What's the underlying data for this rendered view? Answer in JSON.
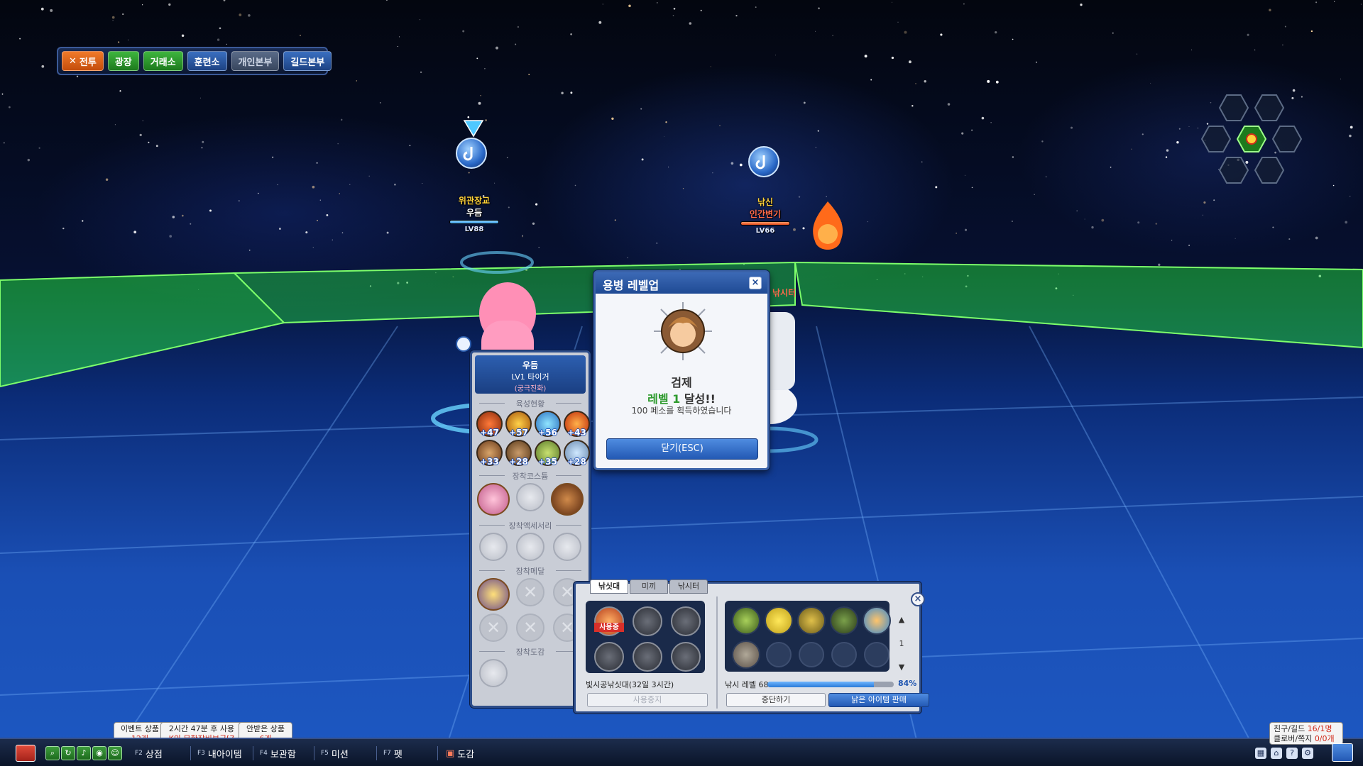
{
  "top_nav": {
    "battle": "전투",
    "plaza": "광장",
    "exchange": "거래소",
    "training": "훈련소",
    "personal_hq": "개인본부",
    "guild_hq": "길드본부"
  },
  "players": {
    "left": {
      "title": "위관장교",
      "name": "우듬",
      "level": "LV88"
    },
    "right": {
      "title": "낚신",
      "name": "인간변기",
      "level": "LV66",
      "status": "낚시터"
    }
  },
  "levelup_dialog": {
    "title": "용병 레벨업",
    "close_x": "×",
    "merc_name": "검제",
    "level_prefix": "레벨 1",
    "level_suffix": " 달성!!",
    "reward": "100 페소를 획득하였습니다",
    "close_button": "닫기(ESC)"
  },
  "char_panel": {
    "name": "우듬",
    "level": "LV1 타이거",
    "evolution": "(궁극진화)",
    "sections": {
      "growth": "육성현황",
      "costume": "장착코스튬",
      "accessory": "장착액세서리",
      "medal": "장착메달",
      "collection": "장착도감"
    },
    "growth_values": [
      "+47",
      "+57",
      "+56",
      "+43",
      "+33",
      "+28",
      "+35",
      "+28"
    ]
  },
  "fishing_panel": {
    "tabs": [
      "낚싯대",
      "미끼",
      "낚시터"
    ],
    "in_use_tag": "사용중",
    "rod_name": "빛시공낚싯대(32일 3시간)",
    "use_button": "사용중지",
    "page_number": "1",
    "fishing_level_label": "낚시 레벨 68",
    "fishing_level_progress_pct": 84,
    "fishing_level_pct_text": "84%",
    "stop_button": "중단하기",
    "sell_button": "낡은 아이템 판매",
    "close_x": "×"
  },
  "bottom_bar": {
    "shop": "상점",
    "shop_key": "F2",
    "my_items": "내아이템",
    "my_items_key": "F3",
    "storage": "보관함",
    "storage_key": "F4",
    "mission": "미션",
    "mission_key": "F5",
    "pet": "펫",
    "pet_key": "F7",
    "collection": "도감",
    "notices": [
      {
        "line1": "이벤트 상품",
        "line2": "12개"
      },
      {
        "line1": "2시간 47분 후 사용",
        "line2": "K의 무한장비보급[7"
      },
      {
        "line1": "안받은 상품",
        "line2": "6개"
      }
    ],
    "friends_label": "친구/길드",
    "friends_value": "16/1명",
    "club_label": "클로버/쪽지",
    "club_value": "0/0개"
  },
  "colors": {
    "accent_blue": "#2359b4",
    "level_green": "#2d9a2d",
    "alert_red": "#d12a1a",
    "floor_green": "#2bff3c"
  }
}
